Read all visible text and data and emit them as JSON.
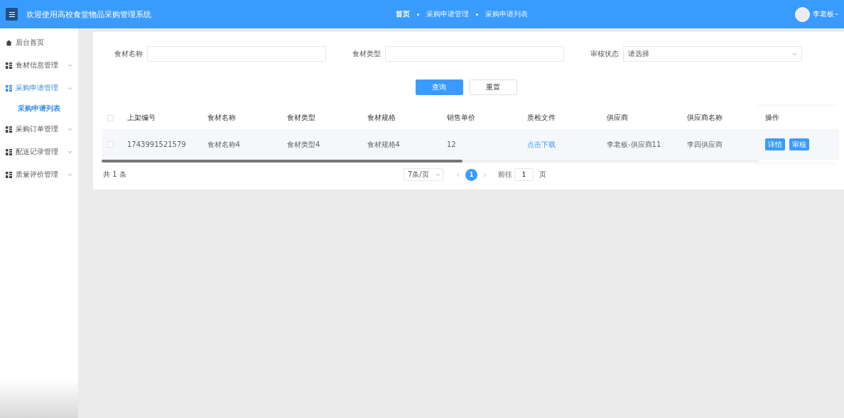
{
  "header": {
    "title": "欢迎使用高校食堂物品采购管理系统",
    "breadcrumbs": [
      {
        "label": "首页",
        "selected": true
      },
      {
        "label": "采购申请管理",
        "selected": false
      },
      {
        "label": "采购申请列表",
        "selected": false
      }
    ],
    "user": "李老板"
  },
  "sidebar": {
    "items": [
      {
        "label": "后台首页",
        "kind": "home",
        "selected": false
      },
      {
        "label": "食材信息管理",
        "kind": "group",
        "expanded": false,
        "selected": false
      },
      {
        "label": "采购申请管理",
        "kind": "group",
        "expanded": true,
        "selected": true,
        "children": [
          {
            "label": "采购申请列表",
            "selected": true
          }
        ]
      },
      {
        "label": "采购订单管理",
        "kind": "group",
        "expanded": false,
        "selected": false
      },
      {
        "label": "配送记录管理",
        "kind": "group",
        "expanded": false,
        "selected": false
      },
      {
        "label": "质量评价管理",
        "kind": "group",
        "expanded": false,
        "selected": false
      }
    ]
  },
  "filters": [
    {
      "label": "食材名称",
      "kind": "input"
    },
    {
      "label": "食材类型",
      "kind": "input"
    },
    {
      "label": "审核状态",
      "kind": "select",
      "placeholder": "请选择"
    }
  ],
  "buttons": [
    {
      "label": "查询",
      "kind": "primary"
    },
    {
      "label": "重置",
      "kind": "plain"
    }
  ],
  "table": {
    "header_checked": false,
    "columns": [
      "上架编号",
      "食材名称",
      "食材类型",
      "食材规格",
      "销售单价",
      "质检文件",
      "供应商",
      "供应商名称"
    ],
    "action_column": "操作",
    "rows": [
      {
        "checked": false,
        "cells": [
          {
            "text": "1743991521579",
            "kind": "text"
          },
          {
            "text": "食材名称4",
            "kind": "text"
          },
          {
            "text": "食材类型4",
            "kind": "text"
          },
          {
            "text": "食材规格4",
            "kind": "text"
          },
          {
            "text": "12",
            "kind": "text"
          },
          {
            "text": "点击下载",
            "kind": "link"
          },
          {
            "text": "李老板-供应商11",
            "kind": "text"
          },
          {
            "text": "李四供应商",
            "kind": "text"
          }
        ],
        "actions": [
          "详情",
          "审核"
        ]
      }
    ]
  },
  "pagination": {
    "total": "共 1 条",
    "page_size": "7条/页",
    "pages": [
      {
        "label": "1",
        "selected": true
      }
    ],
    "goto_label": "前往",
    "goto_value": "1",
    "suffix": "页"
  }
}
